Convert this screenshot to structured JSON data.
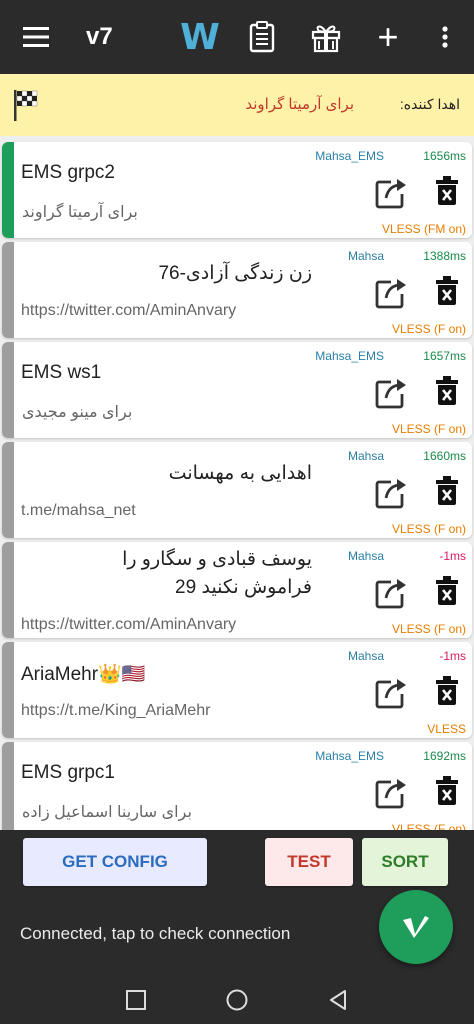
{
  "topbar": {
    "title": "v7",
    "w_label": "W",
    "plus_label": "+",
    "icons": [
      "menu-icon",
      "clipboard-icon",
      "gift-icon",
      "more-vert-icon"
    ]
  },
  "banner": {
    "donor_label": "اهدا کننده:",
    "donor_name": "برای آرمیتا گراوند",
    "icon": "checkered-flag-icon"
  },
  "servers": [
    {
      "name": "EMS grpc2",
      "sub": "برای آرمیتا گراوند",
      "group": "Mahsa_EMS",
      "delay": "1656ms",
      "protocol": "VLESS (FM on)"
    },
    {
      "name": "زن زندگی آزادی-76",
      "sub": "https://twitter.com/AminAnvary",
      "group": "Mahsa",
      "delay": "1388ms",
      "protocol": "VLESS (F on)"
    },
    {
      "name": "EMS ws1",
      "sub": "برای مینو مجیدی",
      "group": "Mahsa_EMS",
      "delay": "1657ms",
      "protocol": "VLESS (F on)"
    },
    {
      "name": "اهدایی به مهسانت",
      "sub": "t.me/mahsa_net",
      "group": "Mahsa",
      "delay": "1660ms",
      "protocol": "VLESS (F on)"
    },
    {
      "name": "یوسف قبادی و سگارو را فراموش نکنید 29",
      "sub": "https://twitter.com/AminAnvary",
      "group": "Mahsa",
      "delay": "-1ms",
      "protocol": "VLESS (F on)"
    },
    {
      "name": "AriaMehr👑🇺🇸",
      "sub": "https://t.me/King_AriaMehr",
      "group": "Mahsa",
      "delay": "-1ms",
      "protocol": "VLESS"
    },
    {
      "name": "EMS grpc1",
      "sub": "برای سارینا اسماعیل زاده",
      "group": "Mahsa_EMS",
      "delay": "1692ms",
      "protocol": "VLESS (F on)"
    }
  ],
  "actions": {
    "get_config": "GET CONFIG",
    "test": "TEST",
    "sort": "SORT"
  },
  "status": {
    "text": "Connected, tap to check connection"
  },
  "fab": {
    "label": "V",
    "icon": "v-logo-icon"
  },
  "nav": {
    "icons": [
      "recents-icon",
      "home-icon",
      "back-icon"
    ]
  },
  "colors": {
    "accent": "#1e9e5a",
    "bar": "#2b2b2b",
    "banner": "#fdf2a8",
    "group": "#2a7fa8",
    "delay_good": "#1b8a4a",
    "delay_bad": "#d81b60",
    "protocol": "#e67e00"
  }
}
